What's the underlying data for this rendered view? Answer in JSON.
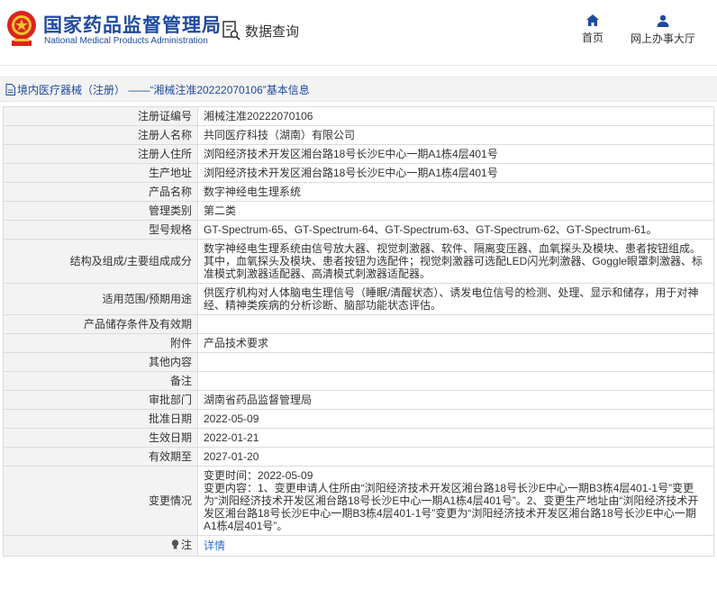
{
  "header": {
    "brand_cn": "国家药品监督管理局",
    "brand_en": "National Medical Products Administration",
    "query_label": "数据查询",
    "nav": [
      {
        "label": "首页",
        "icon": "home-icon"
      },
      {
        "label": "网上办事大厅",
        "icon": "user-icon"
      }
    ],
    "brand_color": "#1e4a9e"
  },
  "breadcrumb": "境内医疗器械（注册） ——“湘械注准20222070106”基本信息",
  "rows": [
    {
      "label": "注册证编号",
      "value": "湘械注准20222070106"
    },
    {
      "label": "注册人名称",
      "value": "共同医疗科技（湖南）有限公司"
    },
    {
      "label": "注册人住所",
      "value": "浏阳经济技术开发区湘台路18号长沙E中心一期A1栋4层401号"
    },
    {
      "label": "生产地址",
      "value": "浏阳经济技术开发区湘台路18号长沙E中心一期A1栋4层401号"
    },
    {
      "label": "产品名称",
      "value": "数字神经电生理系统"
    },
    {
      "label": "管理类别",
      "value": "第二类"
    },
    {
      "label": "型号规格",
      "value": "GT-Spectrum-65、GT-Spectrum-64、GT-Spectrum-63、GT-Spectrum-62、GT-Spectrum-61。"
    },
    {
      "label": "结构及组成/主要组成成分",
      "value": "数字神经电生理系统由信号放大器、视觉刺激器、软件、隔离变压器、血氧探头及模块、患者按钮组成。其中，血氧探头及模块、患者按钮为选配件；视觉刺激器可选配LED闪光刺激器、Goggle眼罩刺激器、标准模式刺激器适配器、高清模式刺激器适配器。"
    },
    {
      "label": "适用范围/预期用途",
      "value": "供医疗机构对人体脑电生理信号（睡眠/清醒状态）、诱发电位信号的检测、处理、显示和储存，用于对神经、精神类疾病的分析诊断、脑部功能状态评估。"
    },
    {
      "label": "产品储存条件及有效期",
      "value": ""
    },
    {
      "label": "附件",
      "value": "产品技术要求"
    },
    {
      "label": "其他内容",
      "value": ""
    },
    {
      "label": "备注",
      "value": ""
    },
    {
      "label": "审批部门",
      "value": "湖南省药品监督管理局"
    },
    {
      "label": "批准日期",
      "value": "2022-05-09"
    },
    {
      "label": "生效日期",
      "value": "2022-01-21"
    },
    {
      "label": "有效期至",
      "value": "2027-01-20"
    }
  ],
  "change": {
    "label": "变更情况",
    "time": "变更时间：2022-05-09",
    "content": "变更内容：1、变更申请人住所由“浏阳经济技术开发区湘台路18号长沙E中心一期B3栋4层401-1号”变更为“浏阳经济技术开发区湘台路18号长沙E中心一期A1栋4层401号”。2、变更生产地址由“浏阳经济技术开发区湘台路18号长沙E中心一期B3栋4层401-1号”变更为“浏阳经济技术开发区湘台路18号长沙E中心一期A1栋4层401号”。"
  },
  "note": {
    "label": "注",
    "icon": "lightbulb-icon",
    "link": "详情"
  }
}
